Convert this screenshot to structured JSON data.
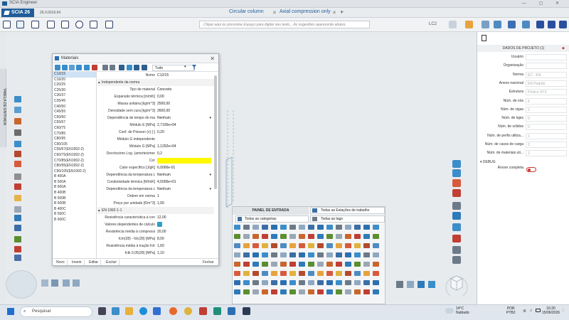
{
  "window": {
    "title": "SCIA Engineer",
    "controls": "— ▢ ✕"
  },
  "tabs": {
    "app": "SCIA 26",
    "version": "26.0.0016.64",
    "doc1": "Circular column",
    "doc2": "Axial compression only",
    "add": "+"
  },
  "toolbar": {
    "command_placeholder": "Clique aqui ou pressione Espaço para digitar seu texto... As sugestões aparecerão abaixo.",
    "lc": "LC2"
  },
  "left_tab": "TABELA DE ENTRADA",
  "materials": {
    "title": "Materiais",
    "filter": "Tudo",
    "list": [
      "C12/15",
      "C16/20",
      "C20/25",
      "C25/30",
      "C30/37",
      "C35/45",
      "C40/50",
      "C45/55",
      "C50/60",
      "C55/67",
      "C60/75",
      "C70/85",
      "C80/95",
      "C90/105",
      "C55/67(EN1992-2)",
      "C60/75(EN1992-2)",
      "C70/85(EN1992-2)",
      "C80/95(EN1992-2)",
      "C90/105(EN1992-2)",
      "B 400A",
      "B 500A",
      "B 600A",
      "B 400B",
      "B 500B",
      "B 600B",
      "B 400C",
      "B 500C",
      "B 600C"
    ],
    "props": [
      {
        "k": "Nome",
        "v": "C12/15"
      },
      {
        "k": "Independente da norma",
        "v": "",
        "sec": true
      },
      {
        "k": "Tipo de material",
        "v": "Concreto"
      },
      {
        "k": "Expansão térmica [m/mK]",
        "v": "0,00"
      },
      {
        "k": "Massa unitária [kg/m^3]",
        "v": "2500,00"
      },
      {
        "k": "Densidade sem cura [kg/m^3]",
        "v": "2600,00"
      },
      {
        "k": "Dependência de tempo do ma",
        "v": "Nenhum"
      },
      {
        "k": "Módulo E [MPa]",
        "v": "2,7100e+04"
      },
      {
        "k": "Coef. de Poisson (v) [-]",
        "v": "0,20"
      },
      {
        "k": "Módulo G independente",
        "v": ""
      },
      {
        "k": "Módulo G [MPa]",
        "v": "1,1292e+04"
      },
      {
        "k": "Decréscimo Log. (amortecimer",
        "v": "0,2"
      },
      {
        "k": "Cor",
        "v": "",
        "yellow": true
      },
      {
        "k": "Calor específico [J/gK]",
        "v": "6,0000e-01"
      },
      {
        "k": "Dependência da temperatura c",
        "v": "Nenhum"
      },
      {
        "k": "Condutividade térmica [W/mK]",
        "v": "4,5000e+01"
      },
      {
        "k": "Dependência da temperatura c",
        "v": "Nenhum"
      },
      {
        "k": "Ordem em norma",
        "v": "1"
      },
      {
        "k": "Preço por unidade [€/m^3]",
        "v": "1,00"
      },
      {
        "k": "EN 1992-1-1",
        "v": "",
        "sec": true
      },
      {
        "k": "Resistência característica à con",
        "v": "12,00"
      },
      {
        "k": "Valores dependentes de cálculo",
        "v": "",
        "check": true
      },
      {
        "k": "Resistência média à compressi",
        "v": "20,00"
      },
      {
        "k": "fcm(28) - fck(28) [MPa]",
        "v": "8,00"
      },
      {
        "k": "Resistência média à tração fctr",
        "v": "1,60"
      },
      {
        "k": "fctk 0,05(28) [MPa]",
        "v": "1,10"
      }
    ],
    "buttons": [
      "Novo",
      "Inserir",
      "Editar",
      "Excluir"
    ],
    "close": "Fechar"
  },
  "input_panel": {
    "title": "PAINEL DE ENTRADA",
    "categories": "Todas as categorias",
    "stations": "Todas as Estações de trabalho",
    "tags": "Todas as tags"
  },
  "project": {
    "title": "DADOS DE PROJETO (1)",
    "rows": [
      {
        "k": "Usuário",
        "v": ""
      },
      {
        "k": "Organização",
        "v": ""
      },
      {
        "k": "Norma",
        "v": "EC - EN"
      },
      {
        "k": "Anexo nacional",
        "v": "EN Padrão"
      },
      {
        "k": "Estrutura",
        "v": "Pórtico XYZ"
      },
      {
        "k": "Núm. de nós",
        "v": "6"
      },
      {
        "k": "Núm. de vigas",
        "v": "2"
      },
      {
        "k": "Núm. de lajes",
        "v": "0"
      },
      {
        "k": "Núm. de sólidos",
        "v": "0"
      },
      {
        "k": "Núm. de perfis utiliza...",
        "v": "1"
      },
      {
        "k": "Núm. de casos de carga",
        "v": "2"
      },
      {
        "k": "Núm. de materiais uti...",
        "v": "2"
      }
    ],
    "debug": "DEBUG",
    "tree_label": "Árvore completa"
  },
  "taskbar": {
    "search": "Pesquisar",
    "temp": "14°C",
    "weather": "Nublado",
    "lang1": "POR",
    "lang2": "PTB2",
    "time": "16:20",
    "date": "15/06/2026"
  },
  "colors": {
    "accent": "#1f5c99",
    "yellow": "#fff800",
    "check": "#2ba0c4"
  }
}
